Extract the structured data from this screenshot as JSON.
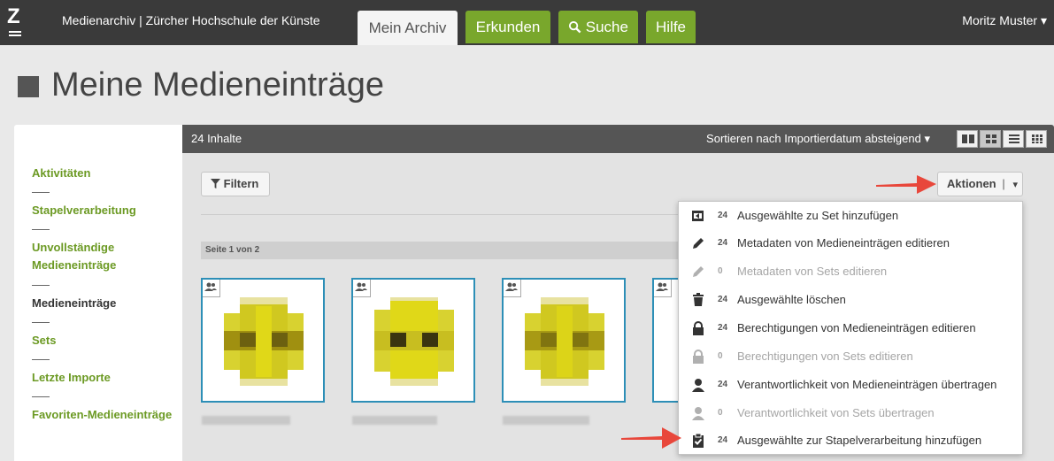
{
  "header": {
    "logo": "Z",
    "site_title": "Medienarchiv | Zürcher Hochschule der Künste",
    "tabs": [
      {
        "label": "Mein Archiv",
        "active": true
      },
      {
        "label": "Erkunden"
      },
      {
        "label": "Suche",
        "icon": "search-icon"
      },
      {
        "label": "Hilfe"
      }
    ],
    "user": "Moritz Muster ▾"
  },
  "page_title": "Meine Medieneinträge",
  "sidebar": {
    "items": [
      {
        "label": "Aktivitäten"
      },
      {
        "label": "Stapelverarbeitung"
      },
      {
        "label": "Unvollständige Medieneinträge"
      },
      {
        "label": "Medieneinträge",
        "active": true
      },
      {
        "label": "Sets"
      },
      {
        "label": "Letzte Importe"
      },
      {
        "label": "Favoriten-Medieneinträge"
      }
    ]
  },
  "toolbar": {
    "count": "24 Inhalte",
    "sort": "Sortieren nach Importierdatum absteigend ▾",
    "views": [
      "tiles-large-icon",
      "grid-icon",
      "list-icon",
      "grid-small-icon"
    ],
    "filter": "Filtern",
    "actions": "Aktionen",
    "actions_caret": "▾",
    "page_label": "Seite 1 von 2"
  },
  "menu": {
    "items": [
      {
        "count": "24",
        "label": "Ausgewählte zu Set hinzufügen",
        "icon": "add-to-set-icon",
        "disabled": false
      },
      {
        "count": "24",
        "label": "Metadaten von Medieneinträgen editieren",
        "icon": "pencil-icon",
        "disabled": false
      },
      {
        "count": "0",
        "label": "Metadaten von Sets editieren",
        "icon": "pencil-icon",
        "disabled": true
      },
      {
        "count": "24",
        "label": "Ausgewählte löschen",
        "icon": "trash-icon",
        "disabled": false
      },
      {
        "count": "24",
        "label": "Berechtigungen von Medieneinträgen editieren",
        "icon": "lock-icon",
        "disabled": false
      },
      {
        "count": "0",
        "label": "Berechtigungen von Sets editieren",
        "icon": "lock-icon",
        "disabled": true
      },
      {
        "count": "24",
        "label": "Verantwortlichkeit von Medieneinträgen übertragen",
        "icon": "user-icon",
        "disabled": false
      },
      {
        "count": "0",
        "label": "Verantwortlichkeit von Sets übertragen",
        "icon": "user-icon",
        "disabled": true
      },
      {
        "count": "24",
        "label": "Ausgewählte zur Stapelverarbeitung hinzufügen",
        "icon": "clipboard-check-icon",
        "disabled": false
      }
    ]
  },
  "colors": {
    "accent": "#79a72c",
    "topbar": "#3a3a3a",
    "arrow": "#e8473b",
    "selection": "#2d8fb7"
  }
}
